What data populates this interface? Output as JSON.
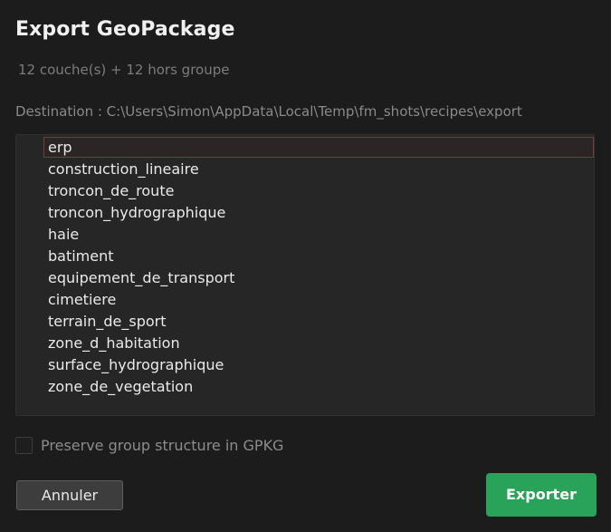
{
  "dialog": {
    "title": "Export GeoPackage",
    "summary": "12 couche(s) + 12 hors groupe",
    "destination": "Destination : C:\\Users\\Simon\\AppData\\Local\\Temp\\fm_shots\\recipes\\export"
  },
  "layers": [
    {
      "label": "erp",
      "selected": true
    },
    {
      "label": "construction_lineaire",
      "selected": false
    },
    {
      "label": "troncon_de_route",
      "selected": false
    },
    {
      "label": "troncon_hydrographique",
      "selected": false
    },
    {
      "label": "haie",
      "selected": false
    },
    {
      "label": "batiment",
      "selected": false
    },
    {
      "label": "equipement_de_transport",
      "selected": false
    },
    {
      "label": "cimetiere",
      "selected": false
    },
    {
      "label": "terrain_de_sport",
      "selected": false
    },
    {
      "label": "zone_d_habitation",
      "selected": false
    },
    {
      "label": "surface_hydrographique",
      "selected": false
    },
    {
      "label": "zone_de_vegetation",
      "selected": false
    }
  ],
  "options": {
    "preserve_label": "Preserve group structure in GPKG",
    "preserve_checked": false
  },
  "buttons": {
    "cancel_label": "Annuler",
    "export_label": "Exporter"
  },
  "colors": {
    "background": "#1c1c1c",
    "list_background": "#262626",
    "selection_border": "#7a3a3a",
    "export_button": "#2aa35a",
    "cancel_button": "#3d3d3d"
  }
}
